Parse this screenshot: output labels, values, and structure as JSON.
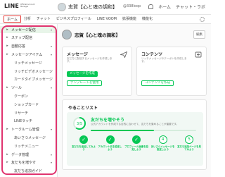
{
  "header": {
    "logo": "LINE",
    "logo_sub": "Official Account Manager",
    "account_name": "志賀【心と魂の調和】",
    "account_id": "@338loop",
    "right_items": [
      "ホーム",
      "チャット・ラボ"
    ]
  },
  "nav": {
    "tabs": [
      "ホーム",
      "分析",
      "チャット",
      "ビジネスプロフィール",
      "LINE VOOM",
      "拡張機能",
      "機能化"
    ],
    "active_index": 0
  },
  "sidebar": {
    "items": [
      {
        "label": "メッセージ配信",
        "level": "top",
        "icon": "▸",
        "chevron": "▾",
        "selected": true
      },
      {
        "label": "ステップ配信",
        "level": "top",
        "icon": "▸"
      },
      {
        "label": "自動応答",
        "level": "top",
        "icon": "▸",
        "chevron": "▾"
      },
      {
        "label": "メッセージアイテム",
        "level": "top",
        "icon": "▸",
        "chevron": "▾"
      },
      {
        "label": "リッチメッセージ",
        "level": "sub"
      },
      {
        "label": "リッチビデオメッセージ",
        "level": "sub"
      },
      {
        "label": "カードタイプメッセージ",
        "level": "sub"
      },
      {
        "label": "ツール",
        "level": "top",
        "icon": "▸",
        "chevron": "▾"
      },
      {
        "label": "クーポン",
        "level": "sub"
      },
      {
        "label": "ショップカード",
        "level": "sub"
      },
      {
        "label": "リサーチ",
        "level": "sub"
      },
      {
        "label": "LINEラッチ",
        "level": "sub"
      },
      {
        "label": "トークルーム管理",
        "level": "top",
        "icon": "▸",
        "chevron": "▾"
      },
      {
        "label": "あいさつメッセージ",
        "level": "sub"
      },
      {
        "label": "リッチメニュー",
        "level": "sub"
      },
      {
        "label": "データ管理",
        "level": "top",
        "icon": "▸",
        "chevron": "▾"
      },
      {
        "label": "友だちを増やす",
        "level": "top",
        "icon": "▸",
        "chevron": "▾"
      },
      {
        "label": "友だち追加ガイド",
        "level": "sub"
      }
    ]
  },
  "main": {
    "profile_name": "志賀【心と魂の調和】",
    "edit_label": "編集",
    "message_card": {
      "title": "メッセージ",
      "desc": "友だちに配信するメッセージを作成します。",
      "primary_button": "メッセージを作成",
      "secondary_button": "テンプレートを使用"
    },
    "content_card": {
      "title": "コンテンツ",
      "desc": "リッチメッセージやクーポンを作成します。",
      "button": "コンテンツを作成"
    },
    "todo": {
      "title": "やることリスト",
      "progress_label": "3/5",
      "progress_fraction": 0.6,
      "heading": "友だちを増やそう",
      "subtext": "公式アカウントを作成する目的に合わせて、友だちを集めることが重要です。",
      "steps": [
        {
          "label": "友だちを追加してみよう",
          "done": true
        },
        {
          "label": "アカウント名を設定しよう",
          "done": true
        },
        {
          "label": "プロフィール画像を設定しよう",
          "done": true
        },
        {
          "label": "あいさつメッセージを設定しよう",
          "done": false,
          "num": "4"
        },
        {
          "label": "友だち追加ページを見てみよう",
          "done": false,
          "num": "5"
        }
      ]
    }
  },
  "colors": {
    "brand_green": "#06c755",
    "annotation_pink": "#e0336e",
    "nav_active_border": "#e53935"
  }
}
